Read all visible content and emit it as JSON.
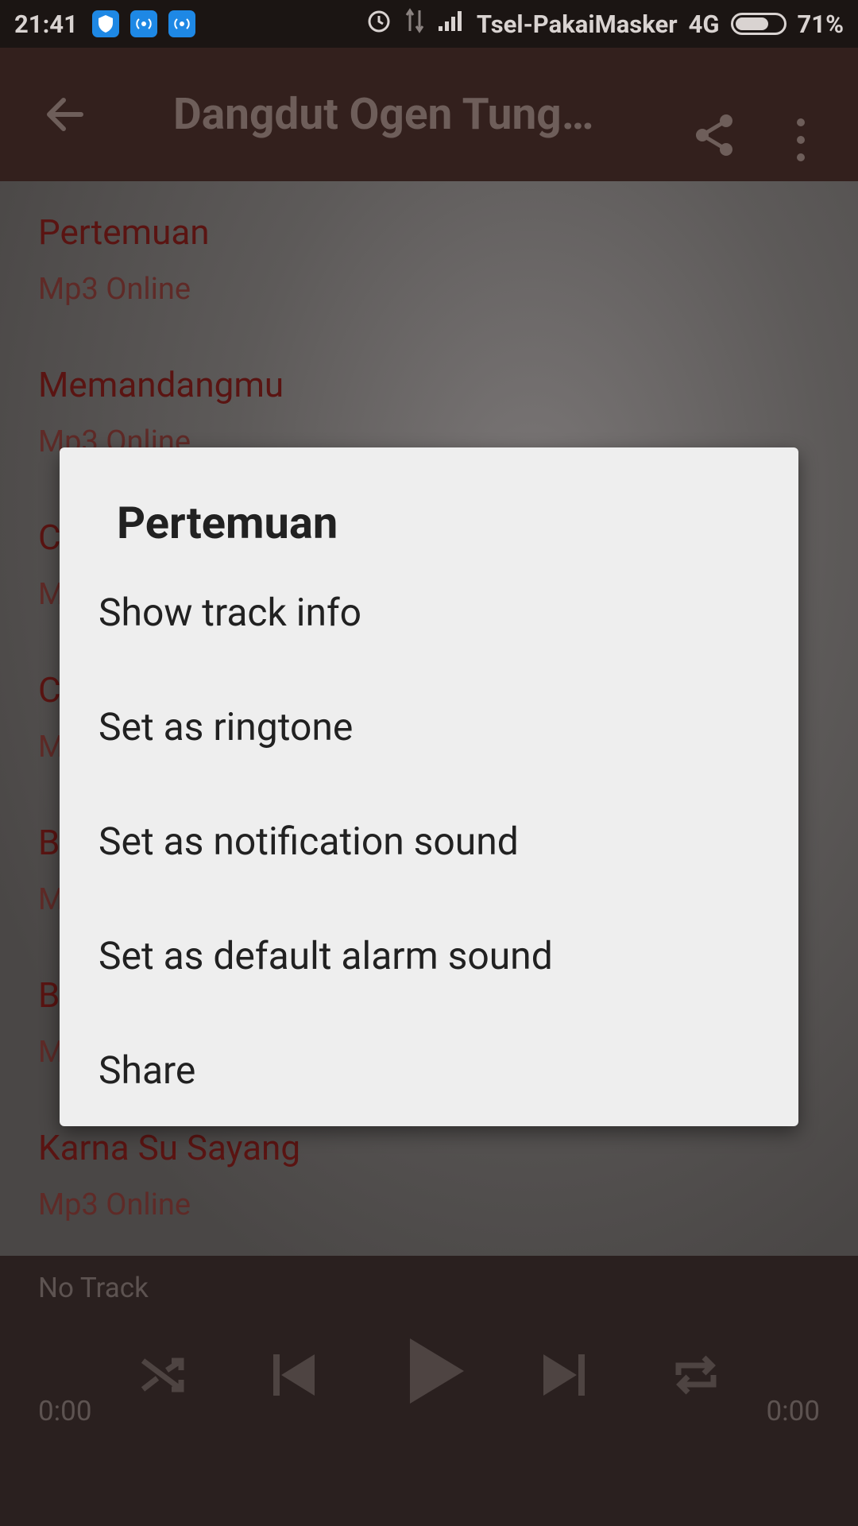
{
  "status_bar": {
    "time": "21:41",
    "carrier": "Tsel-PakaiMasker",
    "network": "4G",
    "battery_percent": "71%",
    "battery_level": 0.71
  },
  "app_bar": {
    "title": "Dangdut Ogen  Tung…"
  },
  "tracks": [
    {
      "name": "Pertemuan",
      "sub": "Mp3 Online"
    },
    {
      "name": "Memandangmu",
      "sub": "Mp3 Online"
    },
    {
      "name": "C",
      "sub": "M"
    },
    {
      "name": "C",
      "sub": "M"
    },
    {
      "name": "B",
      "sub": "M"
    },
    {
      "name": "B",
      "sub": "M"
    },
    {
      "name": "Karna Su Sayang",
      "sub": "Mp3 Online"
    }
  ],
  "player": {
    "now_playing": "No Track",
    "elapsed": "0:00",
    "duration": "0:00"
  },
  "dialog": {
    "title": "Pertemuan",
    "items": [
      {
        "label": "Show track info"
      },
      {
        "label": "Set as ringtone"
      },
      {
        "label": "Set as notification sound"
      },
      {
        "label": "Set as default alarm sound"
      },
      {
        "label": "Share"
      }
    ]
  },
  "colors": {
    "app_bar": "#33201d",
    "dialog_bg": "#eeeeee",
    "track_title": "#5a1412"
  },
  "icons": {
    "status": [
      "shield-icon",
      "hotspot-icon",
      "hotspot-icon",
      "alarm-icon",
      "data-icon",
      "signal-icon",
      "battery-icon"
    ],
    "app_bar": [
      "back-arrow-icon",
      "share-icon",
      "more-vert-icon"
    ],
    "player": [
      "shuffle-icon",
      "skip-previous-icon",
      "play-icon",
      "skip-next-icon",
      "repeat-icon"
    ]
  }
}
